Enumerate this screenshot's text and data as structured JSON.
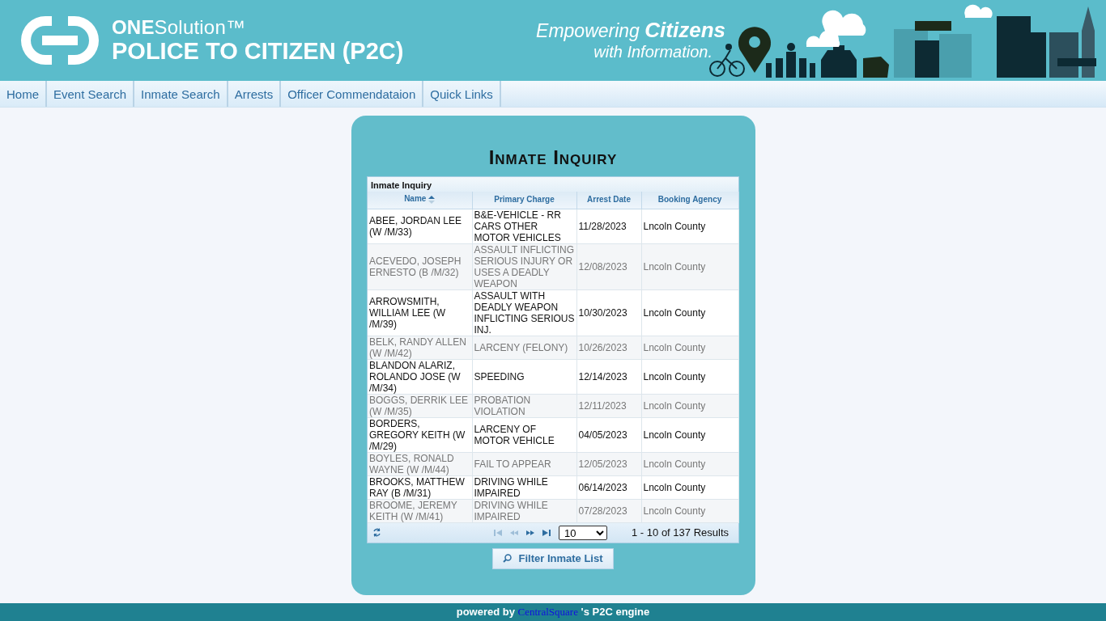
{
  "header": {
    "brand": "**ONE**Solution™",
    "product": "POLICE TO CITIZEN (P2C)",
    "tagline_line_1": "Empowering **Citizens**",
    "tagline_line_2": "with Information."
  },
  "nav": [
    "Home",
    "Event Search",
    "Inmate Search",
    "Arrests",
    "Officer Commendataion",
    "Quick Links"
  ],
  "panel": {
    "title": "Inmate Inquiry",
    "grid": {
      "caption": "Inmate Inquiry",
      "columns": [
        {
          "label": "Name",
          "sorted": true
        },
        {
          "label": "Primary Charge",
          "sorted": false
        },
        {
          "label": "Arrest Date",
          "sorted": false
        },
        {
          "label": "Booking Agency",
          "sorted": false
        }
      ],
      "rows": [
        {
          "name": "ABEE, JORDAN LEE (W /M/33)",
          "charge": "B&E-VEHICLE - RR CARS OTHER MOTOR VEHICLES",
          "date": "11/28/2023",
          "agency": "Lncoln County"
        },
        {
          "name": "ACEVEDO, JOSEPH ERNESTO (B /M/32)",
          "charge": "ASSAULT INFLICTING SERIOUS INJURY OR USES A DEADLY WEAPON",
          "date": "12/08/2023",
          "agency": "Lncoln County"
        },
        {
          "name": "ARROWSMITH, WILLIAM LEE (W /M/39)",
          "charge": "ASSAULT WITH DEADLY WEAPON INFLICTING SERIOUS INJ.",
          "date": "10/30/2023",
          "agency": "Lncoln County"
        },
        {
          "name": "BELK, RANDY ALLEN (W /M/42)",
          "charge": "LARCENY (FELONY)",
          "date": "10/26/2023",
          "agency": "Lncoln County"
        },
        {
          "name": "BLANDON ALARIZ, ROLANDO JOSE (W /M/34)",
          "charge": "SPEEDING",
          "date": "12/14/2023",
          "agency": "Lncoln County"
        },
        {
          "name": "BOGGS, DERRIK LEE (W /M/35)",
          "charge": "PROBATION VIOLATION",
          "date": "12/11/2023",
          "agency": "Lncoln County"
        },
        {
          "name": "BORDERS, GREGORY KEITH (W /M/29)",
          "charge": "LARCENY OF MOTOR VEHICLE",
          "date": "04/05/2023",
          "agency": "Lncoln County"
        },
        {
          "name": "BOYLES, RONALD WAYNE (W /M/44)",
          "charge": "FAIL TO APPEAR",
          "date": "12/05/2023",
          "agency": "Lncoln County"
        },
        {
          "name": "BROOKS, MATTHEW RAY (B /M/31)",
          "charge": "DRIVING WHILE IMPAIRED",
          "date": "06/14/2023",
          "agency": "Lncoln County"
        },
        {
          "name": "BROOME, JEREMY KEITH (W /M/41)",
          "charge": "DRIVING WHILE IMPAIRED",
          "date": "07/28/2023",
          "agency": "Lncoln County"
        }
      ],
      "pager": {
        "first_disabled": true,
        "prev_disabled": true,
        "next_disabled": false,
        "last_disabled": false,
        "page_size": "10",
        "summary": "1 - 10 of 137 Results"
      }
    },
    "filter_button": "Filter Inmate List"
  },
  "footer": {
    "prefix": "powered by",
    "link": "CentralSquare",
    "suffix": "'s P2C engine"
  }
}
